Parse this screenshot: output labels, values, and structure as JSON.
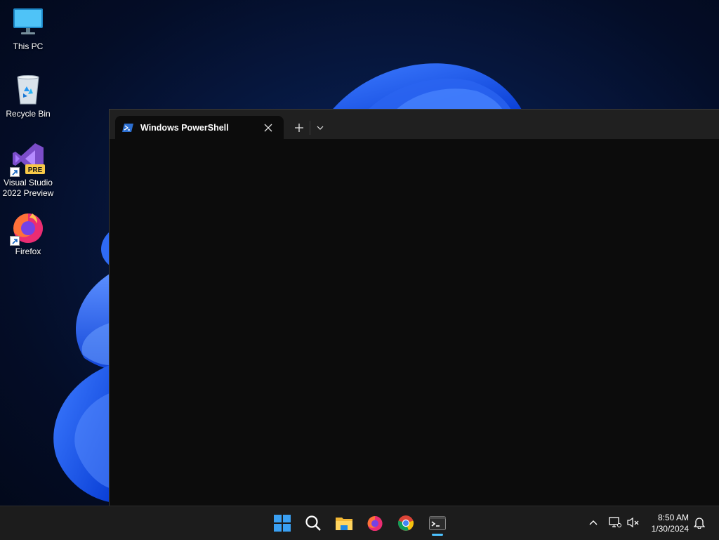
{
  "desktop": {
    "icons": [
      {
        "label": "This PC",
        "icon": "monitor-icon"
      },
      {
        "label": "Recycle Bin",
        "icon": "recycle-bin-icon"
      },
      {
        "label": "Visual Studio 2022 Preview",
        "icon": "visual-studio-icon",
        "badge": "PRE"
      },
      {
        "label": "Firefox",
        "icon": "firefox-icon"
      }
    ]
  },
  "terminal": {
    "tab_title": "Windows PowerShell",
    "tab_icon": "powershell-icon"
  },
  "taskbar": {
    "apps": [
      "start-icon",
      "search-icon",
      "file-explorer-icon",
      "firefox-icon",
      "chrome-icon",
      "terminal-icon"
    ],
    "active_app": "terminal-icon",
    "accent": "#4cc2ff"
  },
  "tray": {
    "time": "8:50 AM",
    "date": "1/30/2024"
  },
  "colors": {
    "terminal_bg": "#0c0c0c",
    "titlebar_bg": "#202020",
    "taskbar_bg": "#1c1c1c"
  }
}
